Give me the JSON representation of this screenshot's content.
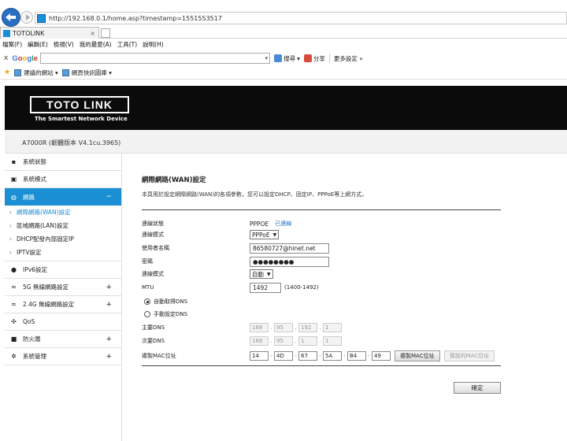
{
  "browser": {
    "url": "http://192.168.0.1/home.asp?timestamp=1551553517",
    "tab_title": "TOTOLINK",
    "tab_close": "×",
    "menu": [
      "檔案(F)",
      "編輯(E)",
      "檢視(V)",
      "我的最愛(A)",
      "工具(T)",
      "說明(H)"
    ],
    "google_x": "x",
    "google_logo": "Google",
    "toolbar": {
      "search": "搜尋",
      "share": "分享",
      "more": "更多設定 »"
    },
    "favorites": [
      "建議的網站 ▾",
      "網頁快訊圖庫 ▾"
    ]
  },
  "router": {
    "logo": "TOTO LINK",
    "tagline": "The Smartest Network Device",
    "model": "A7000R (韌體版本 V4.1cu.3965)"
  },
  "sidebar": {
    "items": [
      {
        "icon": "▪",
        "label": "系統狀態"
      },
      {
        "icon": "▣",
        "label": "系統模式"
      },
      {
        "icon": "◍",
        "label": "網路",
        "suffix": "−"
      },
      {
        "label": "網際網路(WAN)設定"
      },
      {
        "label": "區域網路(LAN)設定"
      },
      {
        "label": "DHCP配發內部固定IP"
      },
      {
        "label": "IPTV設定"
      },
      {
        "icon": "●",
        "label": "IPv6設定"
      },
      {
        "icon": "≈",
        "label": "5G 無線網路設定",
        "suffix": "+"
      },
      {
        "icon": "≈",
        "label": "2.4G 無線網路設定",
        "suffix": "+"
      },
      {
        "icon": "✣",
        "label": "QoS"
      },
      {
        "icon": "■",
        "label": "防火牆",
        "suffix": "+"
      },
      {
        "icon": "✲",
        "label": "系統管理",
        "suffix": "+"
      }
    ],
    "bullet": "›"
  },
  "wan": {
    "title": "網際網路(WAN)設定",
    "description": "本頁用於設定網際網路(WAN)的各項參數，您可以設定DHCP、固定IP、PPPoE等上網方式。",
    "status_label": "連線狀態",
    "status_value": "PPPOE",
    "status_link": "已連線",
    "mode_label": "連線模式",
    "mode_value": "PPPoE",
    "username_label": "使用者名稱",
    "username_value": "86580727@hinet.net",
    "password_label": "密碼",
    "password_value": "●●●●●●●●",
    "conn_type_label": "連線模式",
    "conn_type_value": "自動",
    "mtu_label": "MTU",
    "mtu_value": "1492",
    "mtu_hint": "(1400-1492)",
    "dns_auto_label": "自動取得DNS",
    "dns_manual_label": "手動設定DNS",
    "primary_dns_label": "主要DNS",
    "primary_dns": [
      "168",
      "95",
      "192",
      "1"
    ],
    "secondary_dns_label": "次要DNS",
    "secondary_dns": [
      "168",
      "95",
      "1",
      "1"
    ],
    "mac_label": "複製MAC位址",
    "mac": [
      "14",
      "4D",
      "67",
      "5A",
      "B4",
      "49"
    ],
    "clone_mac_button": "複製MAC位址",
    "default_mac_button": "預設的MAC位址",
    "ok_button": "確定"
  }
}
